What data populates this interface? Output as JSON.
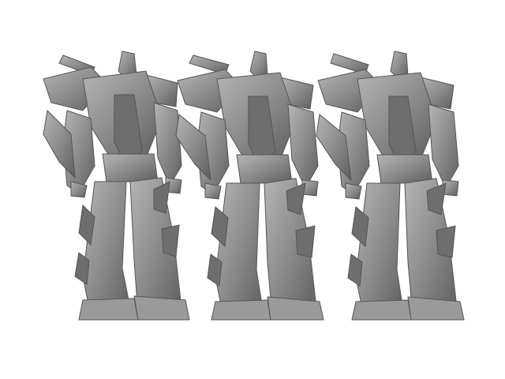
{
  "scene": {
    "background": "#ffffff",
    "model_color": "#8c8c8c",
    "model_shadow": "#5e5e5e",
    "model_highlight": "#b5b5b5",
    "views": [
      "front-left",
      "front",
      "front-right"
    ]
  }
}
